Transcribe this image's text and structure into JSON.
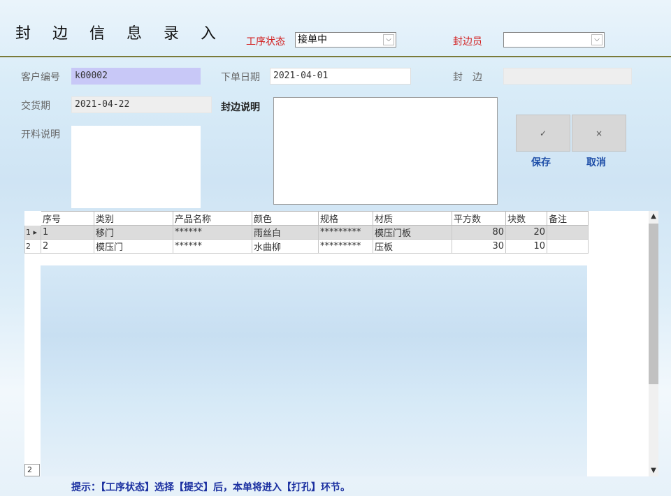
{
  "title": "封 边 信 息 录 入",
  "header": {
    "process_status_label": "工序状态",
    "process_status_value": "接单中",
    "edger_label": "封边员",
    "edger_value": ""
  },
  "form": {
    "customer_no_label": "客户编号",
    "customer_no_value": "k00002",
    "order_date_label": "下单日期",
    "order_date_value": "2021-04-01",
    "edge_label": "封　边",
    "edge_value": "",
    "delivery_label": "交货期",
    "delivery_value": "2021-04-22",
    "edge_note_label": "封边说明",
    "cut_note_label": "开料说明"
  },
  "buttons": {
    "save_icon": "✓",
    "save_label": "保存",
    "cancel_icon": "×",
    "cancel_label": "取消"
  },
  "table": {
    "columns": [
      "序号",
      "类别",
      "产品名称",
      "颜色",
      "规格",
      "材质",
      "平方数",
      "块数",
      "备注"
    ],
    "rows": [
      {
        "row_header": "1 ▸",
        "cells": [
          "1",
          "移门",
          "******",
          "雨丝白",
          "*********",
          "模压门板",
          "80",
          "20",
          ""
        ]
      },
      {
        "row_header": "2",
        "cells": [
          "2",
          "模压门",
          "******",
          "水曲柳",
          "*********",
          "压板",
          "30",
          "10",
          ""
        ]
      }
    ],
    "record_count": "2"
  },
  "hint": "提示：【工序状态】选择【提交】后，本单将进入【打孔】环节。"
}
